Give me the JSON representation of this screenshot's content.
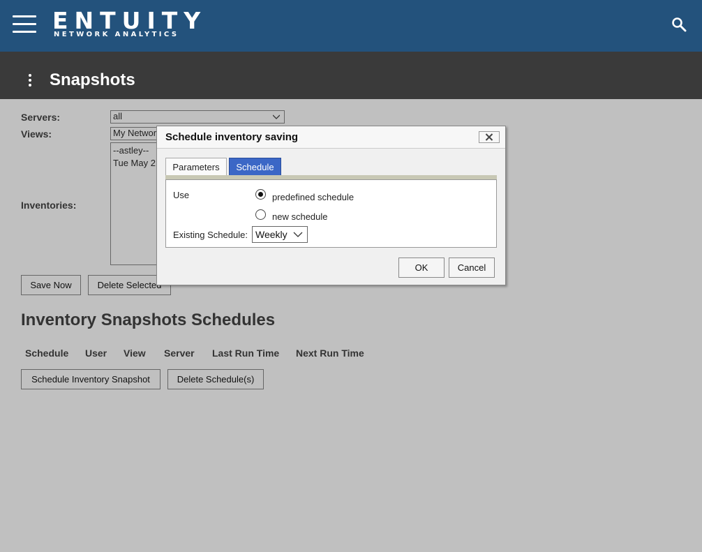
{
  "header": {
    "logo_main": "ENTUITY",
    "logo_sub": "NETWORK ANALYTICS",
    "brand_color": "#23527c"
  },
  "titlebar": {
    "title": "Snapshots"
  },
  "form": {
    "servers_label": "Servers:",
    "servers_value": "all",
    "views_label": "Views:",
    "views_value": "My Network",
    "inventories_label": "Inventories:",
    "inventory_items": [
      "--astley--",
      "Tue May 2"
    ]
  },
  "buttons": {
    "save_now": "Save Now",
    "delete_selected": "Delete Selected",
    "schedule_inventory_snapshot": "Schedule Inventory Snapshot",
    "delete_schedules": "Delete Schedule(s)"
  },
  "schedules": {
    "title": "Inventory Snapshots Schedules",
    "columns": [
      "Schedule",
      "User",
      "View",
      "Server",
      "Last Run Time",
      "Next Run Time"
    ]
  },
  "dialog": {
    "title": "Schedule inventory saving",
    "tabs": [
      {
        "label": "Parameters",
        "active": false
      },
      {
        "label": "Schedule",
        "active": true
      }
    ],
    "use_label": "Use",
    "options": [
      {
        "label": "predefined schedule",
        "checked": true
      },
      {
        "label": "new schedule",
        "checked": false
      }
    ],
    "existing_schedule_label": "Existing Schedule:",
    "existing_schedule_value": "Weekly",
    "ok_label": "OK",
    "cancel_label": "Cancel",
    "active_tab_color": "#3b67c6"
  }
}
